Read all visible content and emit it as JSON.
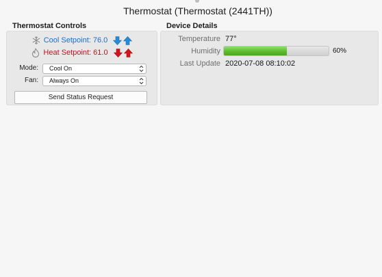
{
  "window": {
    "title": "Thermostat (Thermostat (2441TH))"
  },
  "controls": {
    "section_title": "Thermostat Controls",
    "cool_setpoint_label": "Cool Setpoint: 76.0",
    "heat_setpoint_label": "Heat Setpoint: 61.0",
    "mode_label": "Mode:",
    "mode_value": "Cool On",
    "fan_label": "Fan:",
    "fan_value": "Always On",
    "send_button_label": "Send Status Request",
    "icons": {
      "cool": "snowflake-icon",
      "heat": "flame-icon",
      "decrease": "arrow-down-icon",
      "increase": "arrow-up-icon"
    },
    "colors": {
      "cool": "#1c6dc9",
      "cool_arrow": "#2b8ad8",
      "heat": "#c0141a"
    }
  },
  "details": {
    "section_title": "Device Details",
    "temperature_label": "Temperature",
    "temperature_value": "77°",
    "humidity_label": "Humidity",
    "humidity_percent": 60,
    "humidity_text": "60%",
    "last_update_label": "Last Update",
    "last_update_value": "2020-07-08 08:10:02"
  }
}
